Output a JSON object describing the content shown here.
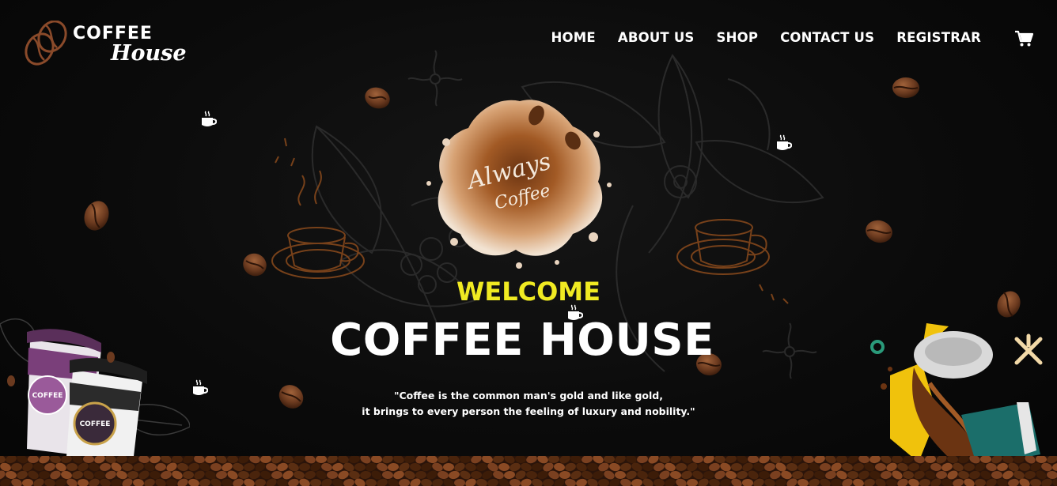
{
  "brand": {
    "line1": "COFFEE",
    "line2": "House",
    "icon": "coffee-beans-icon"
  },
  "nav": {
    "items": [
      {
        "label": "HOME"
      },
      {
        "label": "ABOUT US"
      },
      {
        "label": "SHOP"
      },
      {
        "label": "CONTACT US"
      },
      {
        "label": "REGISTRAR"
      }
    ],
    "cart_icon": "shopping-cart-icon"
  },
  "hero": {
    "splash_line1": "Always",
    "splash_line2": "Coffee",
    "welcome": "WELCOME",
    "title": "COFFEE HOUSE",
    "quote_line1": "\"Coffee is the common man's gold and like gold,",
    "quote_line2": "it brings to every person the feeling of luxury and nobility.\""
  },
  "decor": {
    "cup_label": "COFFEE",
    "accent_color": "#f0ea22",
    "bean_color": "#6b3a1f",
    "sketch_color": "#8a4a1c"
  }
}
